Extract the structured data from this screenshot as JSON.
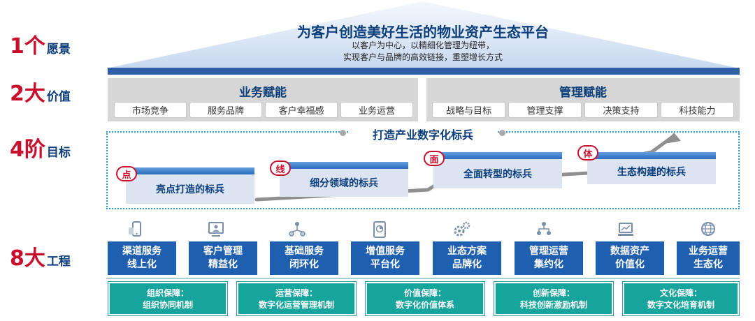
{
  "rows": [
    {
      "num": "1个",
      "label": "愿景"
    },
    {
      "num": "2大",
      "label": "价值"
    },
    {
      "num": "4阶",
      "label": "目标"
    },
    {
      "num": "8大",
      "label": "工程"
    }
  ],
  "vision": {
    "title": "为客户创造美好生活的物业资产生态平台",
    "line1": "以客户为中心，以精细化管理为纽带，",
    "line2": "实现客户与品牌的高效链接，重塑增长方式"
  },
  "values": [
    {
      "title": "业务赋能",
      "chips": [
        "市场竞争",
        "服务品牌",
        "客户幸福感",
        "业务运营"
      ]
    },
    {
      "title": "管理赋能",
      "chips": [
        "战略与目标",
        "管理支撑",
        "决策支持",
        "科技能力"
      ]
    }
  ],
  "goals": {
    "title": "打造产业数字化标兵",
    "steps": [
      {
        "badge": "点",
        "label": "亮点打造的标兵"
      },
      {
        "badge": "线",
        "label": "细分领域的标兵"
      },
      {
        "badge": "面",
        "label": "全面转型的标兵"
      },
      {
        "badge": "体",
        "label": "生态构建的标兵"
      }
    ]
  },
  "projects": [
    {
      "line1": "渠道服务",
      "line2": "线上化",
      "icon": "phone-icon"
    },
    {
      "line1": "客户管理",
      "line2": "精益化",
      "icon": "monitor-user-icon"
    },
    {
      "line1": "基础服务",
      "line2": "闭环化",
      "icon": "network-icon"
    },
    {
      "line1": "增值服务",
      "line2": "平台化",
      "icon": "tablet-chart-icon"
    },
    {
      "line1": "业态方案",
      "line2": "品牌化",
      "icon": "gears-icon"
    },
    {
      "line1": "管理运营",
      "line2": "集约化",
      "icon": "org-chart-icon"
    },
    {
      "line1": "数据资产",
      "line2": "价值化",
      "icon": "laptop-chart-icon"
    },
    {
      "line1": "业务运营",
      "line2": "生态化",
      "icon": "globe-icon"
    }
  ],
  "guarantees": [
    {
      "line1": "组织保障：",
      "line2": "组织协同机制"
    },
    {
      "line1": "运营保障：",
      "line2": "数字化运营管理机制"
    },
    {
      "line1": "价值保障：",
      "line2": "数字化价值体系"
    },
    {
      "line1": "创新保障：",
      "line2": "科技创新激励机制"
    },
    {
      "line1": "文化保障：",
      "line2": "数字文化培育机制"
    }
  ]
}
